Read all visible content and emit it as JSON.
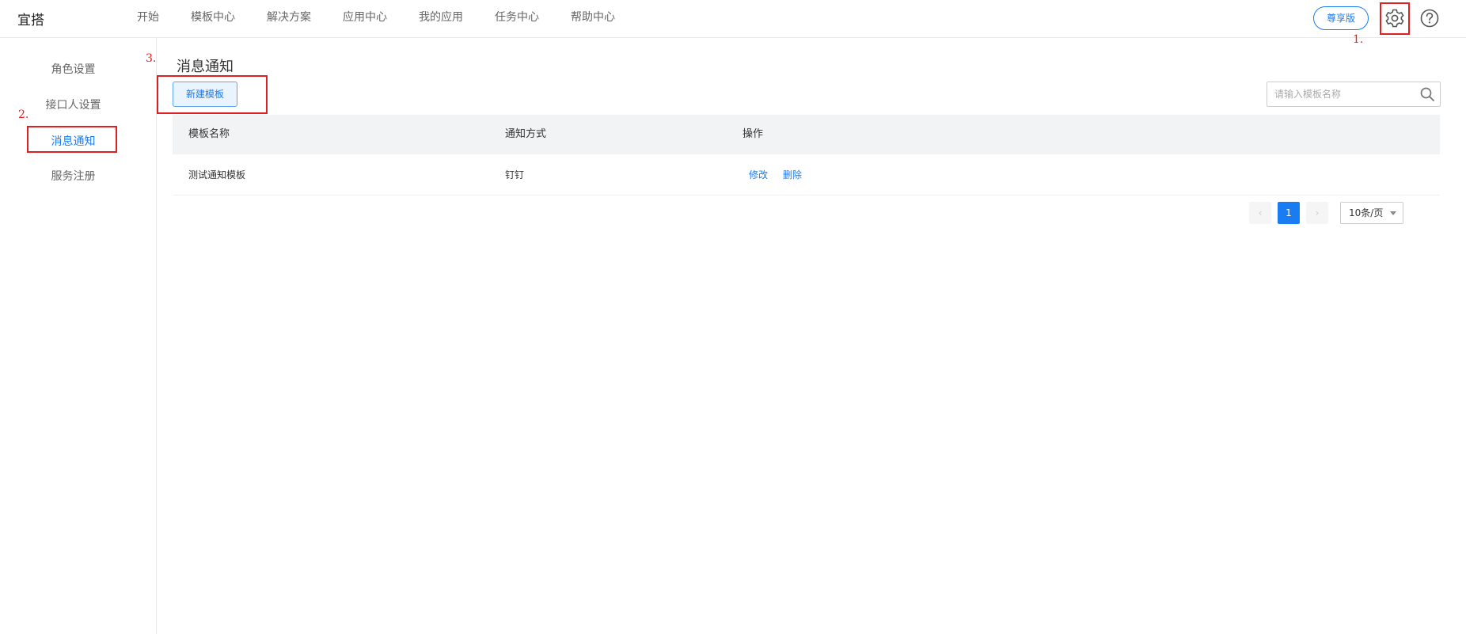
{
  "header": {
    "logo": "宜搭",
    "nav": [
      "开始",
      "模板中心",
      "解决方案",
      "应用中心",
      "我的应用",
      "任务中心",
      "帮助中心"
    ],
    "premium_label": "尊享版",
    "icons": {
      "settings": "gear-icon",
      "help": "question-circle-icon"
    }
  },
  "sidebar": {
    "items": [
      {
        "label": "角色设置",
        "active": false
      },
      {
        "label": "接口人设置",
        "active": false
      },
      {
        "label": "消息通知",
        "active": true
      },
      {
        "label": "服务注册",
        "active": false
      }
    ]
  },
  "main": {
    "title": "消息通知",
    "new_button": "新建模板",
    "search": {
      "placeholder": "请输入模板名称",
      "value": ""
    },
    "table": {
      "columns": [
        "模板名称",
        "通知方式",
        "操作"
      ],
      "rows": [
        {
          "name": "测试通知模板",
          "method": "钉钉",
          "actions": [
            "修改",
            "删除"
          ]
        }
      ]
    },
    "pagination": {
      "prev": "‹",
      "current": "1",
      "next": "›",
      "page_size": "10条/页"
    }
  },
  "annotations": [
    "1.",
    "2.",
    "3."
  ],
  "colors": {
    "accent": "#1a7cf2",
    "annotation": "#e02020",
    "header_bg": "#f2f3f5"
  }
}
